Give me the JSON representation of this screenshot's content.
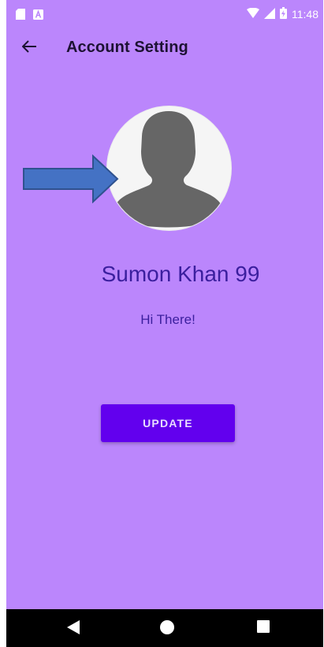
{
  "status_bar": {
    "time": "11:48",
    "icons": [
      "sd-card-icon",
      "a-notification-icon",
      "wifi-icon",
      "signal-icon",
      "battery-charging-icon"
    ]
  },
  "app_bar": {
    "title": "Account Setting",
    "back_icon": "arrow-back-icon"
  },
  "profile": {
    "avatar_icon": "person-placeholder-icon",
    "name": "Sumon Khan 99",
    "status": "Hi There!"
  },
  "actions": {
    "update_label": "UPDATE"
  },
  "annotation": {
    "arrow_icon": "blue-arrow-icon",
    "arrow_color": "#4472c4"
  },
  "colors": {
    "background": "#bb86fc",
    "primary": "#6200ee",
    "text": "#3b1f9e"
  },
  "nav_bar": {
    "buttons": [
      "back-triangle-icon",
      "home-circle-icon",
      "recents-square-icon"
    ]
  }
}
